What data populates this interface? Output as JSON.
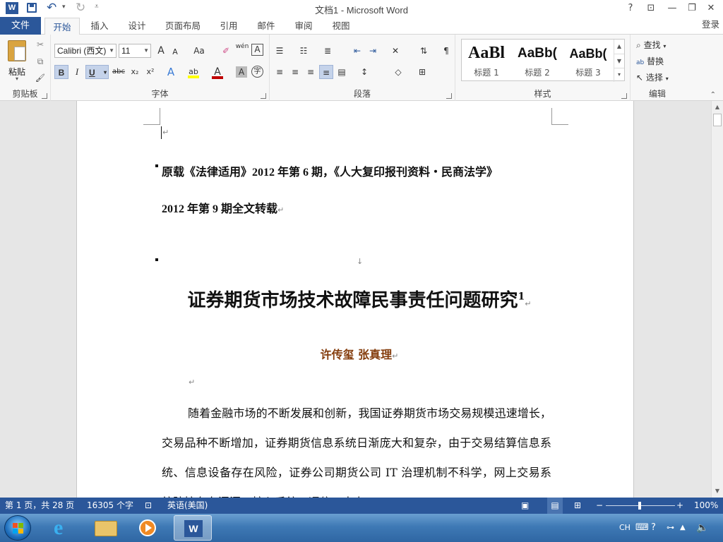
{
  "window": {
    "title": "文档1 - Microsoft Word",
    "help": "?",
    "ribbon_display": "⊡",
    "minimize": "—",
    "restore": "❐",
    "close": "✕"
  },
  "quick_access": {
    "word_icon": "W",
    "save_icon": "save-icon",
    "undo": "↶",
    "undo_drop": "▾",
    "redo": "↻",
    "customize": "⩡"
  },
  "tabs": {
    "file": "文件",
    "items": [
      "开始",
      "插入",
      "设计",
      "页面布局",
      "引用",
      "邮件",
      "审阅",
      "视图"
    ],
    "active_index": 0,
    "login": "登录"
  },
  "ribbon": {
    "clipboard": {
      "label": "剪贴板",
      "paste": "粘贴",
      "cut": "✂",
      "copy": "⧉",
      "format_painter": "🖌"
    },
    "font": {
      "label": "字体",
      "font_name": "Calibri (西文)",
      "font_size": "11",
      "grow": "A",
      "shrink": "A",
      "case": "Aa",
      "clear": "✐",
      "phonetic": "wén",
      "border_char": "A",
      "bold": "B",
      "italic": "I",
      "underline": "U",
      "strike": "abc",
      "subscript": "x₂",
      "superscript": "x²",
      "effects": "A",
      "highlight": "ab",
      "font_color": "A",
      "shading": "A",
      "enclose": "字",
      "highlight_color": "#ffff00",
      "font_color_value": "#c00000"
    },
    "paragraph": {
      "label": "段落"
    },
    "styles": {
      "label": "样式",
      "items": [
        {
          "sample": "AaBl",
          "name": "标题 1"
        },
        {
          "sample": "AaBb(",
          "name": "标题 2"
        },
        {
          "sample": "AaBb(",
          "name": "标题 3"
        }
      ]
    },
    "editing": {
      "label": "编辑",
      "find": "查找",
      "replace": "替换",
      "select": "选择"
    }
  },
  "document": {
    "cursor_mark": "↵",
    "source_line1": "原载《法律适用》2012 年第 6 期，《人大复印报刊资料・民商法学》",
    "source_line2": "2012 年第 9 期全文转载",
    "break_mark": "↓",
    "title": "证券期货市场技术故障民事责任问题研究",
    "footnote": "1",
    "authors": "许传玺  张真理",
    "empty_mark": "↵",
    "body": "随着金融市场的不断发展和创新，我国证券期货市场交易规模迅速增长，交易品种不断增加，证券期货信息系统日渐庞大和复杂，由于交易结算信息系统、信息设备存在风险，证券公司期货公司 IT 治理机制不科学，网上交易系统防控存在漏洞，核心系统、通信、电力"
  },
  "status": {
    "page": "第 1 页，共 28 页",
    "words": "16305 个字",
    "proof_icon": "proofing-icon",
    "language": "英语(美国)",
    "zoom": "100%",
    "zoom_level": 100
  },
  "taskbar": {
    "apps": [
      "internet-explorer",
      "file-explorer",
      "media-player",
      "word"
    ],
    "ime": "CH",
    "tray_icons": [
      "keyboard",
      "help",
      "network",
      "arrow-up",
      "volume"
    ]
  }
}
